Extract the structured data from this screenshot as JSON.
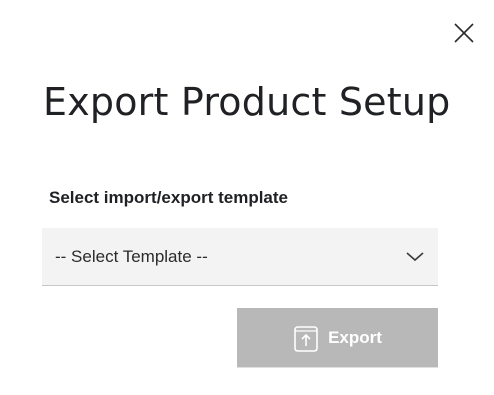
{
  "dialog": {
    "title": "Export Product Setup",
    "close_icon": "close-icon"
  },
  "template_field": {
    "label": "Select import/export template",
    "selected_value": "-- Select Template --",
    "icon": "chevron-down-icon"
  },
  "actions": {
    "export_label": "Export",
    "export_icon": "upload-icon",
    "export_disabled": true
  },
  "colors": {
    "text": "#1f2124",
    "field_background": "#f3f3f3",
    "button_disabled": "#b8b8b8"
  }
}
